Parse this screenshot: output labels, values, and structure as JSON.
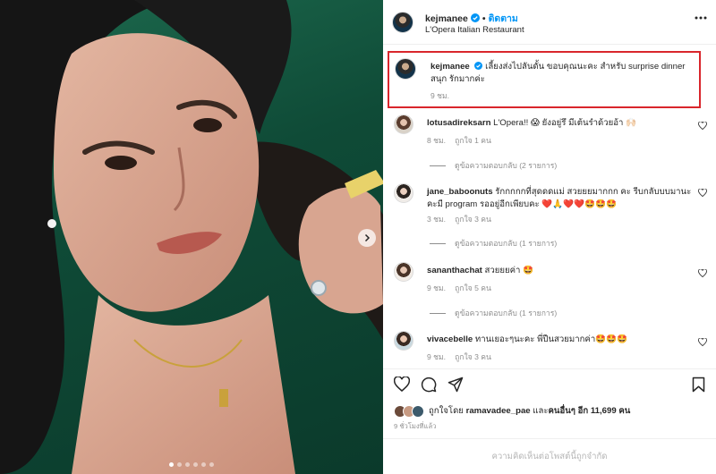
{
  "post": {
    "username": "kejmanee",
    "follow_label": "ติดตาม",
    "location": "L'Opera Italian Restaurant",
    "caption": "เลี้ยงส่งไปลันดั้น ขอบคุณนะคะ สำหรับ surprise dinner สนุก รักมากค่ะ",
    "caption_time": "9 ชม."
  },
  "comments": [
    {
      "username": "lotusadireksarn",
      "text": "L'Opera!! 😱 ยังอยู่รึ มีเต้นรำด้วยอ้า 🙌🏻",
      "time": "8 ชม.",
      "likes": "ถูกใจ 1 คน",
      "replies": "ดูข้อความตอบกลับ (2 รายการ)"
    },
    {
      "username": "jane_baboonuts",
      "text": "รักกกกกที่สุดดดแม่ สวยยยมากกก คะ รีบกลับบบมานะคะมี program รออยู่อีกเพียบคะ ❤️🙏❤️❤️🤩🤩🤩",
      "time": "3 ชม.",
      "likes": "ถูกใจ 3 คน",
      "replies": "ดูข้อความตอบกลับ (1 รายการ)"
    },
    {
      "username": "sananthachat",
      "text": "สวยยยค่า 🤩",
      "time": "9 ชม.",
      "likes": "ถูกใจ 5 คน",
      "replies": "ดูข้อความตอบกลับ (1 รายการ)"
    },
    {
      "username": "vivacebelle",
      "text": "ทานเยอะๆนะคะ พี่ปืนสวยมากค่า🤩🤩🤩",
      "time": "9 ชม.",
      "likes": "ถูกใจ 3 คน",
      "replies": ""
    }
  ],
  "likes": {
    "prefix": "ถูกใจโดย",
    "first_user": "ramavadee_pae",
    "joiner": "และ",
    "others": "คนอื่นๆ อีก 11,699 คน"
  },
  "time_ago": "9 ชั่วโมงที่แล้ว",
  "comments_disabled": "ความคิดเห็นต่อโพสต์นี้ถูกจำกัด",
  "colors": {
    "accent": "#0095f6",
    "highlight_border": "#d9262c",
    "muted": "#8e8e8e",
    "verified": "#0095f6"
  },
  "icons": [
    "verified-icon",
    "more-options-icon",
    "heart-icon",
    "comment-icon",
    "share-icon",
    "bookmark-icon",
    "chevron-right-icon"
  ],
  "carousel": {
    "slides": 6,
    "active": 1
  }
}
